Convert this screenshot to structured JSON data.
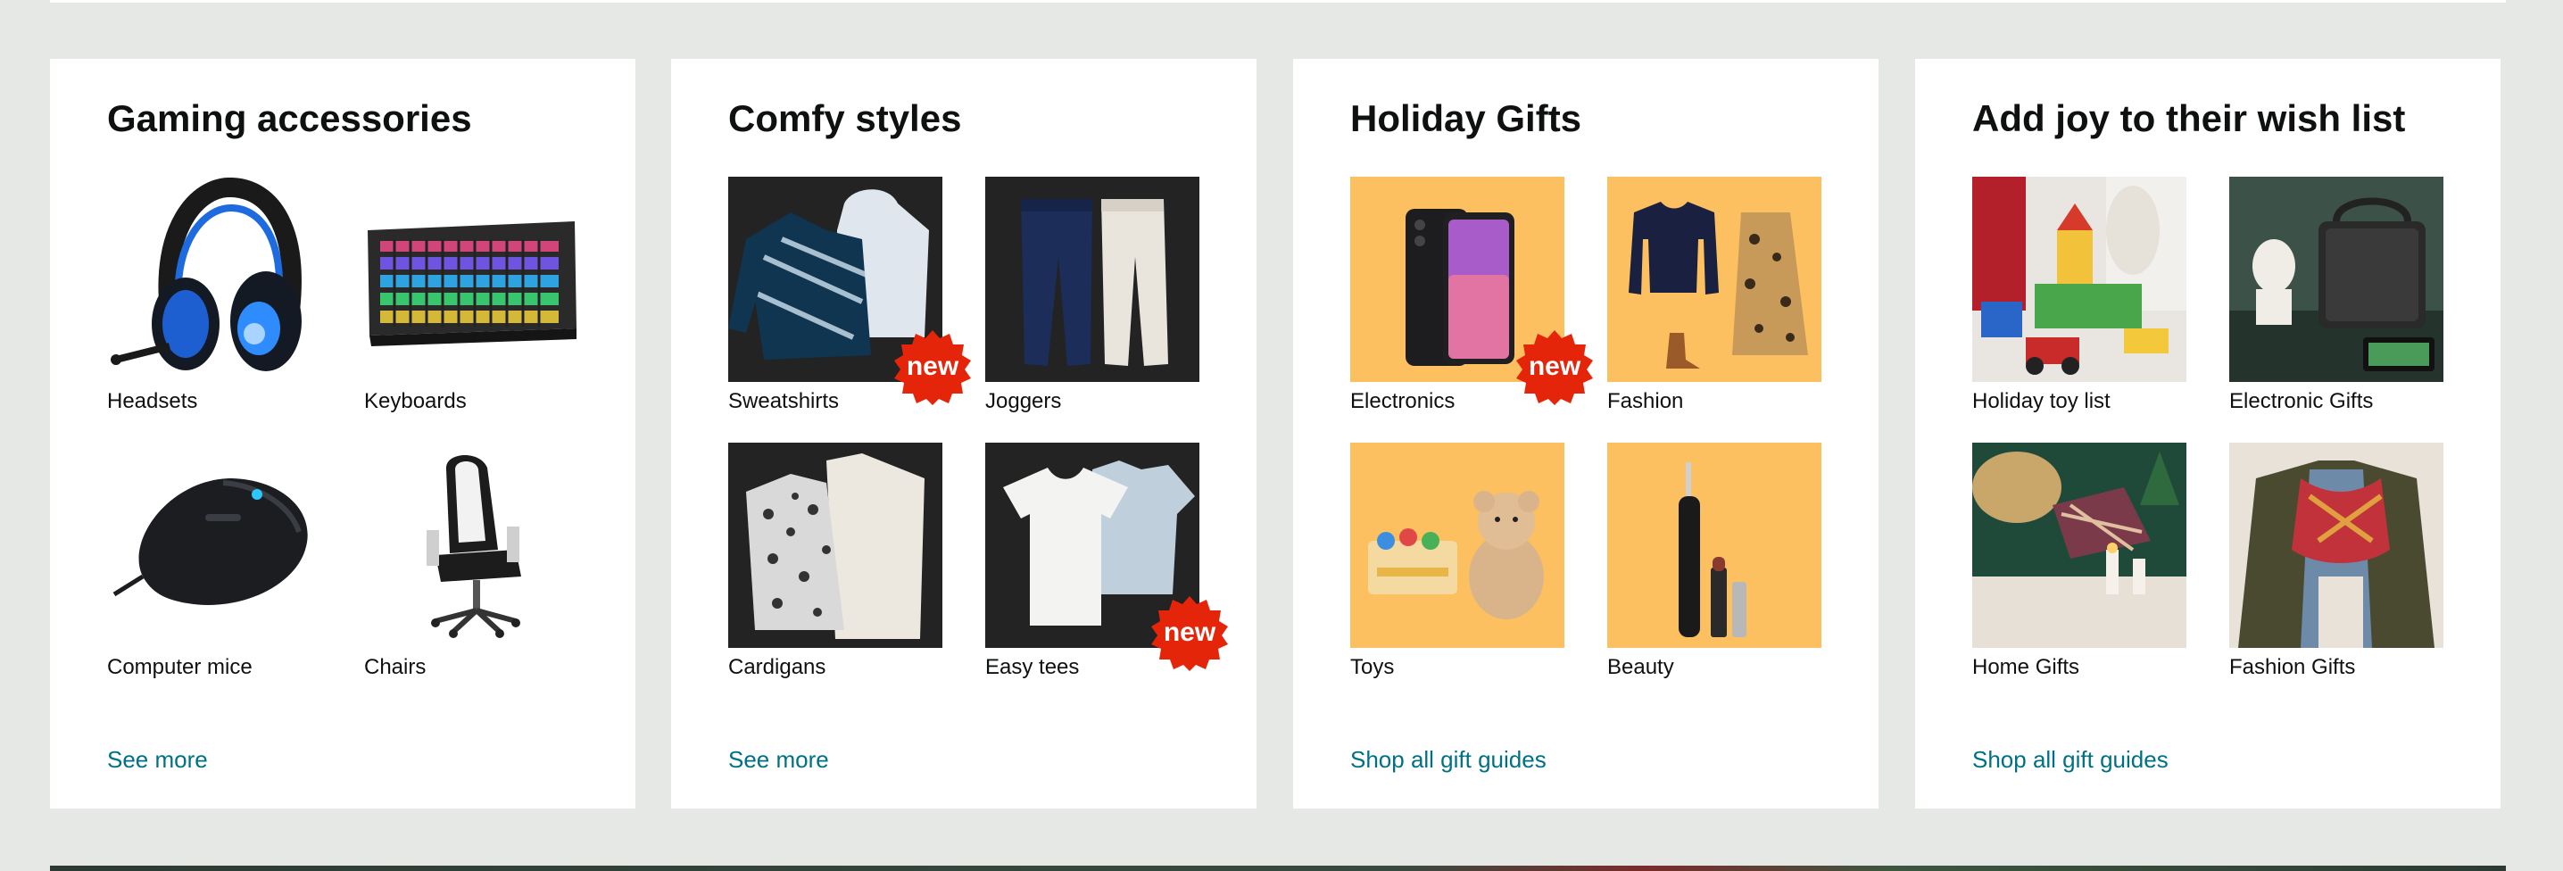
{
  "cards": [
    {
      "title": "Gaming accessories",
      "tiles": [
        {
          "label": "Headsets",
          "icon": "headset-icon"
        },
        {
          "label": "Keyboards",
          "icon": "keyboard-icon"
        },
        {
          "label": "Computer mice",
          "icon": "mouse-icon"
        },
        {
          "label": "Chairs",
          "icon": "chair-icon"
        }
      ],
      "link": "See more"
    },
    {
      "title": "Comfy styles",
      "tiles": [
        {
          "label": "Sweatshirts",
          "badge": "new"
        },
        {
          "label": "Joggers"
        },
        {
          "label": "Cardigans"
        },
        {
          "label": "Easy tees",
          "badge": "new"
        }
      ],
      "link": "See more"
    },
    {
      "title": "Holiday Gifts",
      "tiles": [
        {
          "label": "Electronics",
          "badge": "new"
        },
        {
          "label": "Fashion"
        },
        {
          "label": "Toys"
        },
        {
          "label": "Beauty"
        }
      ],
      "link": "Shop all gift guides"
    },
    {
      "title": "Add joy to their wish list",
      "tiles": [
        {
          "label": "Holiday toy list"
        },
        {
          "label": "Electronic Gifts"
        },
        {
          "label": "Home Gifts"
        },
        {
          "label": "Fashion Gifts"
        }
      ],
      "link": "Shop all gift guides"
    }
  ],
  "colors": {
    "page_background": "#e6e8e6",
    "link": "#007185",
    "badge": "#e4250a",
    "gift_tile_background": "#fdc060",
    "apparel_tile_background": "#232323"
  }
}
